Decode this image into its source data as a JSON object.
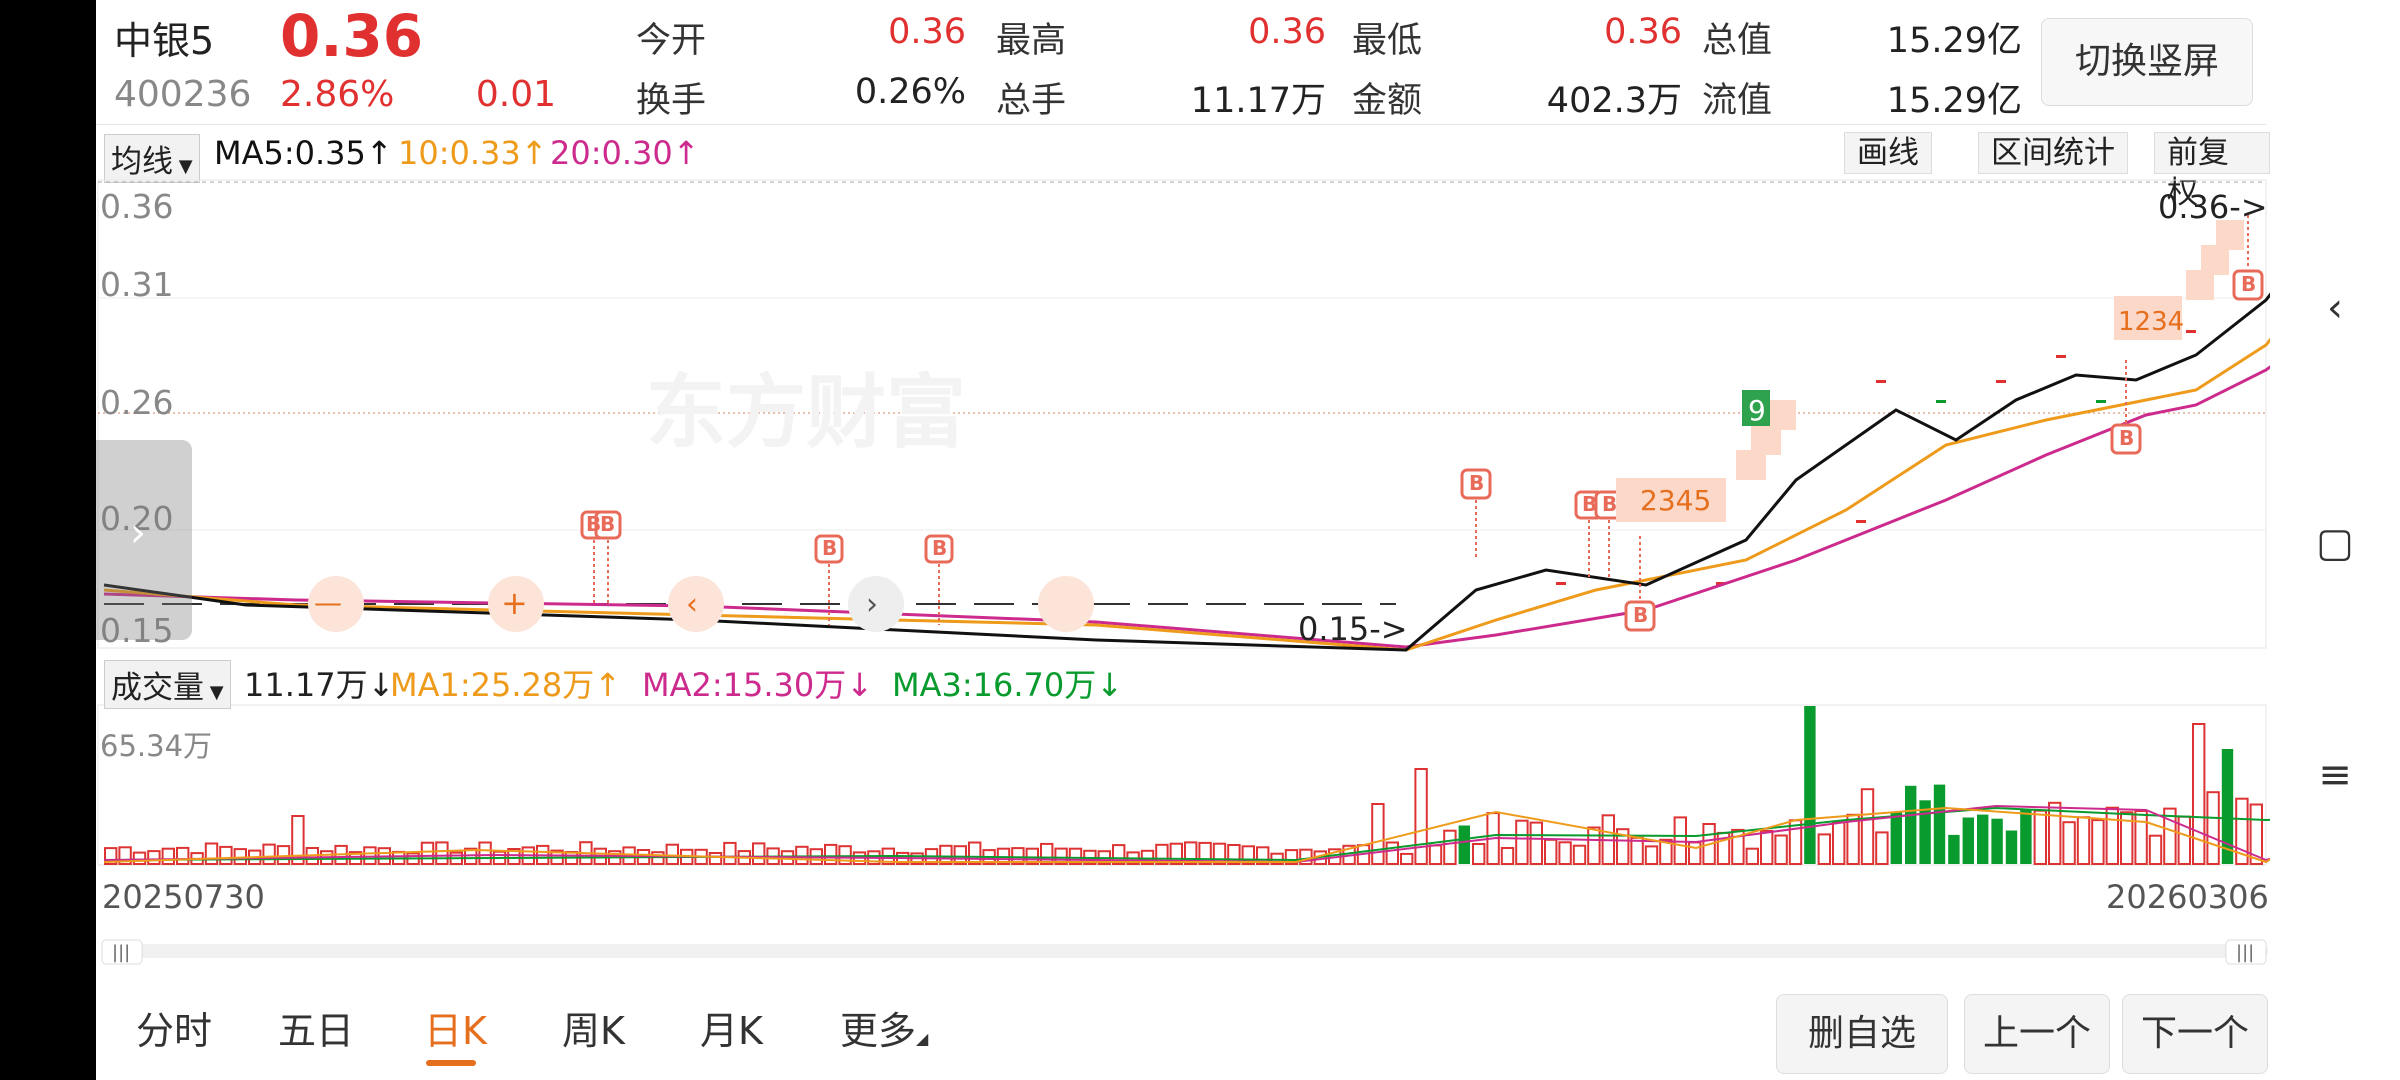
{
  "header": {
    "name": "中银5",
    "price": "0.36",
    "code": "400236",
    "pct": "2.86%",
    "change": "0.01",
    "stats": [
      {
        "label": "今开",
        "value": "0.36"
      },
      {
        "label": "最高",
        "value": "0.36"
      },
      {
        "label": "最低",
        "value": "0.36"
      },
      {
        "label": "总值",
        "value": "15.29亿"
      },
      {
        "label": "换手",
        "value": "0.26%"
      },
      {
        "label": "总手",
        "value": "11.17万"
      },
      {
        "label": "金额",
        "value": "402.3万"
      },
      {
        "label": "流值",
        "value": "15.29亿"
      }
    ],
    "portrait_btn": "切换竖屏"
  },
  "ma_bar": {
    "selector": "均线",
    "ma5": "MA5:0.35",
    "ma10": "10:0.33",
    "ma20": "20:0.30",
    "tools": [
      "画线",
      "区间统计",
      "前复权"
    ]
  },
  "price_axis": [
    "0.36",
    "0.31",
    "0.26",
    "0.20",
    "0.15"
  ],
  "annotations": {
    "low_label": "0.15->",
    "high_label": "0.36->",
    "watermark": "东方财富",
    "seq_a": "2345",
    "seq_b": "1234",
    "count_9": "9"
  },
  "volume_bar": {
    "selector": "成交量",
    "vol": "11.17万",
    "ma1": "MA1:25.28万",
    "ma2": "MA2:15.30万",
    "ma3": "MA3:16.70万",
    "max_label": "65.34万"
  },
  "dates": {
    "start": "20250730",
    "end": "20260306"
  },
  "tabs": [
    "分时",
    "五日",
    "日K",
    "周K",
    "月K",
    "更多"
  ],
  "active_tab": "日K",
  "buttons": {
    "delete": "删自选",
    "prev": "上一个",
    "next": "下一个"
  },
  "colors": {
    "up": "#e03030",
    "down": "#0a9b2e",
    "ma5": "#111111",
    "ma10": "#ee9a1a",
    "ma20": "#cc2b8d",
    "accent": "#e66f1e"
  },
  "chart_data": {
    "type": "candlestick",
    "y_range": [
      0.15,
      0.36
    ],
    "ma_close_series": {
      "name": "MA5",
      "values": [
        0.17,
        0.17,
        0.17,
        0.17,
        0.17,
        0.17,
        0.17,
        0.17,
        0.17,
        0.17,
        0.16,
        0.16,
        0.16,
        0.16,
        0.16,
        0.16,
        0.16,
        0.16,
        0.16,
        0.16,
        0.15,
        0.15,
        0.15,
        0.15,
        0.15,
        0.15,
        0.16,
        0.17,
        0.18,
        0.18,
        0.18,
        0.19,
        0.2,
        0.22,
        0.24,
        0.26,
        0.27,
        0.26,
        0.25,
        0.26,
        0.27,
        0.27,
        0.27,
        0.28,
        0.29,
        0.31,
        0.34,
        0.35
      ]
    }
  }
}
